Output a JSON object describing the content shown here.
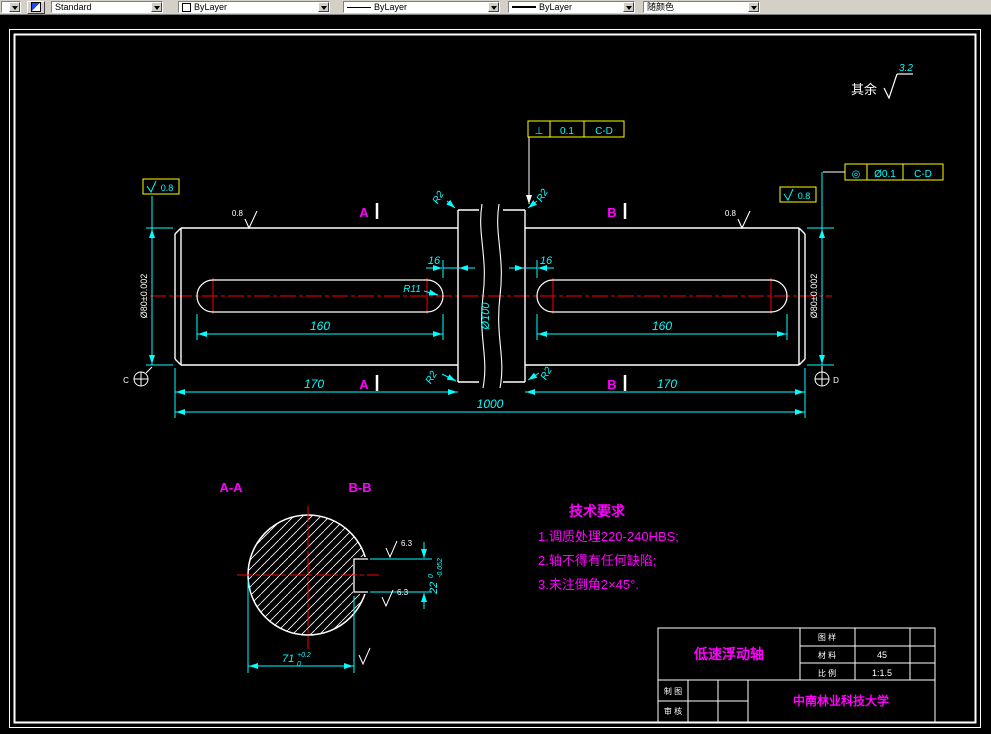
{
  "toolbar": {
    "style": "Standard",
    "color": "ByLayer",
    "linetype": "ByLayer",
    "lineweight": "ByLayer",
    "plot_style": "随颜色"
  },
  "colors": {
    "dimension": "#00ffff",
    "annotation": "#ff00ff",
    "centerline": "#ff0000",
    "outline": "#ffffff",
    "frame_accent": "#ffff00"
  },
  "surface_note": {
    "prefix": "其余",
    "value": "3.2"
  },
  "fcf": {
    "top": {
      "symbol": "⊥",
      "tolerance": "0.1",
      "datum": "C-D"
    },
    "side": {
      "symbol": "◎",
      "tolerance": "Ø0.1",
      "datum": "C-D"
    }
  },
  "dims": {
    "key_offset": "16",
    "key_length": "160",
    "end_length": "170",
    "total_length": "1000",
    "mid_diameter": "Ø100",
    "journal_diameter": "Ø80±0.002",
    "fillet": "R2",
    "key_radius": "R11",
    "key_width": {
      "nominal": "22",
      "upper": "0",
      "lower": "-0.052"
    },
    "key_depth": {
      "nominal": "71",
      "upper": "+0.2",
      "lower": "0"
    }
  },
  "roughness": {
    "fine": "0.8",
    "medium": "6.3"
  },
  "sections": {
    "a": "A",
    "b": "B",
    "aa": "A-A",
    "bb": "B-B"
  },
  "datums": {
    "left": "C",
    "right": "D"
  },
  "tech_req": {
    "title": "技术要求",
    "item1": "1.调质处理220-240HBS;",
    "item2": "2.轴不得有任何缺陷;",
    "item3": "3.未注倒角2×45°."
  },
  "title_block": {
    "part_name": "低速浮动轴",
    "row1_label": "图 样",
    "row1_value": "",
    "row2_label": "材 料",
    "row2_value": "45",
    "row3_label": "比 例",
    "row3_value": "1:1.5",
    "maker_label": "制 图",
    "checker_label": "审 核",
    "school": "中南林业科技大学"
  }
}
